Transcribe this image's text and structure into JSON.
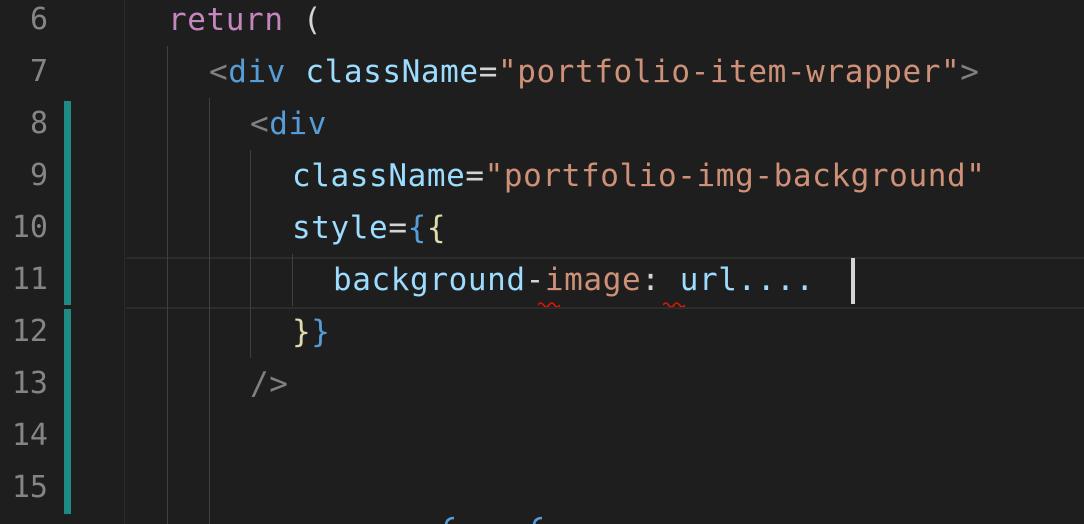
{
  "editor": {
    "theme_colors": {
      "background": "#1e1e1e",
      "line_number": "#858585",
      "keyword": "#c586c0",
      "tag": "#569cd6",
      "attribute": "#9cdcfe",
      "string": "#ce9178",
      "modified_gutter": "#1f8a83"
    },
    "line_numbers": [
      "6",
      "7",
      "8",
      "9",
      "10",
      "11",
      "12",
      "13",
      "14",
      "15"
    ],
    "lines": {
      "l6": {
        "kw": "return",
        "paren": " ("
      },
      "l7": {
        "open": "<",
        "tag": "div",
        "attr": " className",
        "eq": "=",
        "val": "\"portfolio-item-wrapper\"",
        "close": ">"
      },
      "l8": {
        "open": "<",
        "tag": "div"
      },
      "l9": {
        "attr": "className",
        "eq": "=",
        "val": "\"portfolio-img-background\""
      },
      "l10": {
        "attr": "style",
        "eq": "=",
        "brace1": "{",
        "brace2": "{"
      },
      "l11": {
        "a": "background",
        "dash": "-",
        "b": "image",
        "colon": ":",
        "c": " url...."
      },
      "l12": {
        "brace2": "}",
        "brace1": "}"
      },
      "l13": {
        "selfclose": "/>"
      }
    }
  }
}
